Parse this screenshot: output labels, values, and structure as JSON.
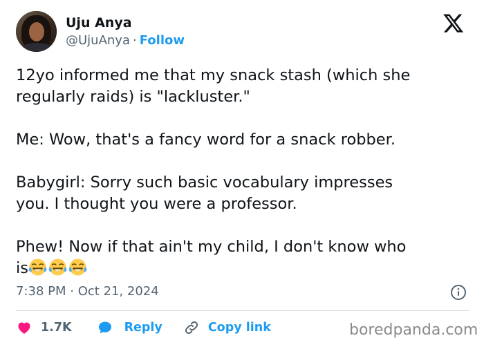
{
  "author": {
    "name": "Uju Anya",
    "handle": "@UjuAnya",
    "separator": "·",
    "follow_label": "Follow",
    "avatar_icon": "profile-photo"
  },
  "platform_logo": "x-logo",
  "tweet": {
    "paragraphs": [
      [
        "12yo informed me that my snack stash (which she",
        "regularly raids) is \"lackluster.\""
      ],
      [
        "Me: Wow, that's a fancy word for a snack robber."
      ],
      [
        "Babygirl: Sorry such basic vocabulary impresses",
        "you. I thought you were a professor."
      ],
      [
        "Phew! Now if that ain't my child, I don't know who"
      ]
    ],
    "last_line_text": "is",
    "trailing_emoji": "face-with-tears-of-joy",
    "trailing_emoji_count": 3
  },
  "timestamp": {
    "time": "7:38 PM",
    "separator": "·",
    "date": "Oct 21, 2024"
  },
  "actions": {
    "like_icon": "heart-icon",
    "like_count": "1.7K",
    "reply_icon": "speech-bubble-icon",
    "reply_label": "Reply",
    "copy_icon": "link-icon",
    "copy_label": "Copy link"
  },
  "watermark": "boredpanda.com",
  "colors": {
    "text": "#0f1419",
    "secondary": "#536471",
    "accent": "#1d9bf0",
    "like": "#f91880",
    "divider": "#cfd9de"
  }
}
